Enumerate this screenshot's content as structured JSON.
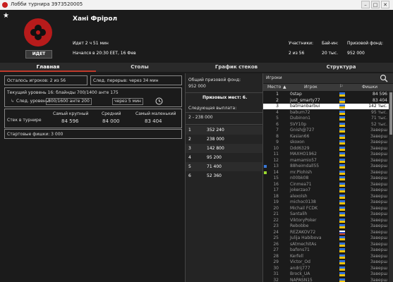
{
  "window": {
    "title": "Лобби турнира 3973520005",
    "btn_min": "–",
    "btn_max": "□",
    "btn_close": "✕"
  },
  "header": {
    "star": "★",
    "status": "ИДЕТ",
    "name": "Хані Фрірол",
    "elapsed": "Идет 2 ч 51 мин",
    "started": "Начался в 20:30 EET, 16 Фев",
    "participants_label": "Участники:",
    "participants_value": "2 из 56",
    "buyin_label": "Бай-ин:",
    "buyin_value": "20 тыс.",
    "prize_label": "Призовой фонд:",
    "prize_value": "952 000"
  },
  "tabs": [
    "Главная",
    "Столы",
    "График стеков",
    "Структура"
  ],
  "main": {
    "players_left": "Осталось игроков: 2 из 56",
    "next_break": "След. перерыв: через 34 мин",
    "current_level": "Текущий уровень 16: блайнды 700/1400 анте 175",
    "next_level_label": "След. уровень:",
    "next_level_value": "800/1600 анте 200",
    "next_level_in": "через 5 мин",
    "stack_label": "Стек в турнире",
    "largest_label": "Самый крупный",
    "largest_value": "84 596",
    "avg_label": "Средний",
    "avg_value": "84 000",
    "smallest_label": "Самый маленький",
    "smallest_value": "83 404",
    "start_chips": "Стартовые фишки: 3 000"
  },
  "prizes": {
    "total_label": "Общий призовой фонд:",
    "total_value": "952 000",
    "places_label": "Призовых мест: 6.",
    "next_label": "Следующая выплата:",
    "next_value": "2 - 238 000",
    "rows": [
      {
        "place": "1",
        "amount": "352 240"
      },
      {
        "place": "2",
        "amount": "238 000"
      },
      {
        "place": "3",
        "amount": "142 800"
      },
      {
        "place": "4",
        "amount": "95 200"
      },
      {
        "place": "5",
        "amount": "71 400"
      },
      {
        "place": "6",
        "amount": "52 360"
      }
    ]
  },
  "players": {
    "title": "Игроки",
    "col_place": "Место",
    "col_player": "Игрок",
    "col_chips": "Фишки",
    "rows": [
      {
        "place": "1",
        "name": "0stap",
        "chips": "84 596",
        "hl": false,
        "flag": "ua"
      },
      {
        "place": "2",
        "name": "just_smarty77",
        "chips": "83 404",
        "hl": false,
        "flag": "ua"
      },
      {
        "place": "3",
        "name": "batmanbarbui",
        "chips": "142 тыс.",
        "hl": true,
        "flag": "ua"
      },
      {
        "place": "4",
        "name": "babum72",
        "chips": "95 тыс.",
        "hl": false,
        "flag": "ua"
      },
      {
        "place": "5",
        "name": "Dubinon1",
        "chips": "71 тыс.",
        "hl": false,
        "flag": "ua"
      },
      {
        "place": "6",
        "name": "SVY10p",
        "chips": "52 тыс.",
        "hl": false,
        "flag": "ua"
      },
      {
        "place": "7",
        "name": "Gnish@727",
        "chips": "Заверш",
        "hl": false,
        "flag": "ua"
      },
      {
        "place": "8",
        "name": "Kasian66",
        "chips": "Заверш",
        "hl": false,
        "flag": "ua"
      },
      {
        "place": "9",
        "name": "skoxon",
        "chips": "Заверш",
        "hl": false,
        "flag": "ua"
      },
      {
        "place": "10",
        "name": "Ddd6329",
        "chips": "Заверш",
        "hl": false,
        "flag": "ua"
      },
      {
        "place": "11",
        "name": "MAXHO1962",
        "chips": "Заверш",
        "hl": false,
        "flag": "ua"
      },
      {
        "place": "12",
        "name": "mamamio57",
        "chips": "Заверш",
        "hl": false,
        "flag": "ua"
      },
      {
        "place": "13",
        "name": "88heimdall55",
        "chips": "Заверш",
        "hl": false,
        "flag": "ua"
      },
      {
        "place": "14",
        "name": "mr.Plohish",
        "chips": "Заверш",
        "hl": false,
        "flag": "ua"
      },
      {
        "place": "15",
        "name": "n00bk08",
        "chips": "Заверш",
        "hl": false,
        "flag": "ua"
      },
      {
        "place": "16",
        "name": "Cinmea71",
        "chips": "Заверш",
        "hl": false,
        "flag": "ua"
      },
      {
        "place": "17",
        "name": "jokerzao7",
        "chips": "Заверш",
        "hl": false,
        "flag": "ua"
      },
      {
        "place": "18",
        "name": "alexolsh",
        "chips": "Заверш",
        "hl": false,
        "flag": "ua"
      },
      {
        "place": "19",
        "name": "michoc0138",
        "chips": "Заверш",
        "hl": false,
        "flag": "ua"
      },
      {
        "place": "20",
        "name": "Michail FCDK",
        "chips": "Заверш",
        "hl": false,
        "flag": "ua"
      },
      {
        "place": "21",
        "name": "Santalih",
        "chips": "Заверш",
        "hl": false,
        "flag": "ua"
      },
      {
        "place": "22",
        "name": "ViktoryPoker",
        "chips": "Заверш",
        "hl": false,
        "flag": "ua"
      },
      {
        "place": "23",
        "name": "Rebobbe",
        "chips": "Заверш",
        "hl": false,
        "flag": "ua"
      },
      {
        "place": "24",
        "name": "REZAKOV72",
        "chips": "Заверш",
        "hl": false,
        "flag": "ru"
      },
      {
        "place": "25",
        "name": "Julija Habibova",
        "chips": "Заверш",
        "hl": false,
        "flag": "ua"
      },
      {
        "place": "26",
        "name": "sAtmechitAs",
        "chips": "Заверш",
        "hl": false,
        "flag": "ua"
      },
      {
        "place": "27",
        "name": "bafons71",
        "chips": "Заверш",
        "hl": false,
        "flag": "ua"
      },
      {
        "place": "28",
        "name": "Kerfell",
        "chips": "Заверш",
        "hl": false,
        "flag": "ua"
      },
      {
        "place": "29",
        "name": "Victor_Od",
        "chips": "Заверш",
        "hl": false,
        "flag": "ua"
      },
      {
        "place": "30",
        "name": "andrij777",
        "chips": "Заверш",
        "hl": false,
        "flag": "ua"
      },
      {
        "place": "31",
        "name": "Brock_UA",
        "chips": "Заверш",
        "hl": false,
        "flag": "ua"
      },
      {
        "place": "32",
        "name": "NAPASN15",
        "chips": "Заверш",
        "hl": false,
        "flag": "ua"
      }
    ]
  }
}
